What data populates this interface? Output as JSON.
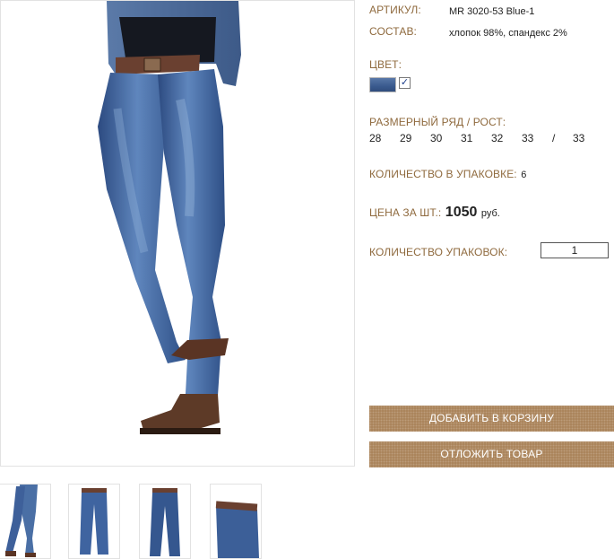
{
  "product": {
    "article_label": "АРТИКУЛ:",
    "article_value": "MR 3020-53 Blue-1",
    "composition_label": "СОСТАВ:",
    "composition_value": "хлопок 98%, спандекс 2%",
    "color_label": "ЦВЕТ:",
    "color_swatch": "#3f5f92",
    "color_checked_mark": "✓",
    "size_label": "РАЗМЕРНЫЙ РЯД / РОСТ:",
    "sizes": [
      "28",
      "29",
      "30",
      "31",
      "32",
      "33",
      "/",
      "33"
    ],
    "pack_qty_label": "КОЛИЧЕСТВО В УПАКОВКЕ:",
    "pack_qty_value": "6",
    "price_label": "ЦЕНА ЗА ШТ.:",
    "price_value": "1050",
    "price_currency": "руб.",
    "packs_label": "КОЛИЧЕСТВО УПАКОВОК:",
    "packs_value": "1"
  },
  "actions": {
    "add_to_cart": "ДОБАВИТЬ В КОРЗИНУ",
    "postpone": "ОТЛОЖИТЬ ТОВАР"
  },
  "colors": {
    "label": "#8f6a3e",
    "button": "#a88055",
    "denim": "#3f5f92"
  }
}
